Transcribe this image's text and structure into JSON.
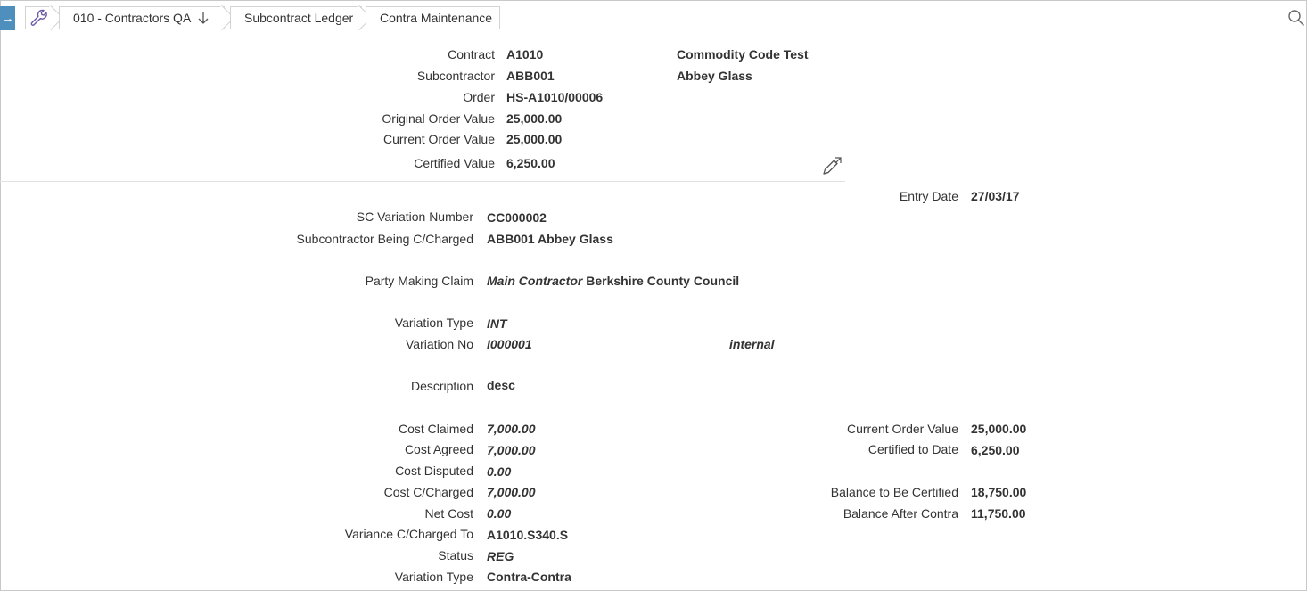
{
  "breadcrumb": {
    "company": "010 - Contractors QA",
    "ledger": "Subcontract Ledger",
    "page": "Contra Maintenance"
  },
  "header": {
    "contract_label": "Contract",
    "contract_value": "A1010",
    "contract_desc": "Commodity Code Test",
    "subcontractor_label": "Subcontractor",
    "subcontractor_value": "ABB001",
    "subcontractor_desc": "Abbey Glass",
    "order_label": "Order",
    "order_value": "HS-A1010/00006",
    "original_order_value_label": "Original Order Value",
    "original_order_value": "25,000.00",
    "current_order_value_label": "Current Order Value",
    "current_order_value": "25,000.00",
    "certified_value_label": "Certified Value",
    "certified_value": "6,250.00"
  },
  "detail": {
    "entry_date_label": "Entry Date",
    "entry_date": "27/03/17",
    "sc_variation_number_label": "SC Variation Number",
    "sc_variation_number": "CC000002",
    "subcontractor_charged_label": "Subcontractor Being C/Charged",
    "subcontractor_charged": "ABB001 Abbey Glass",
    "party_making_claim_label": "Party Making Claim",
    "party_making_claim_type": "Main Contractor",
    "party_making_claim_name": "Berkshire County Council",
    "variation_type_label": "Variation Type",
    "variation_type": "INT",
    "variation_no_label": "Variation No",
    "variation_no": "I000001",
    "variation_no_desc": "internal",
    "description_label": "Description",
    "description": "desc",
    "cost_claimed_label": "Cost Claimed",
    "cost_claimed": "7,000.00",
    "cost_agreed_label": "Cost Agreed",
    "cost_agreed": "7,000.00",
    "cost_disputed_label": "Cost Disputed",
    "cost_disputed": "0.00",
    "cost_ccharged_label": "Cost C/Charged",
    "cost_ccharged": "7,000.00",
    "net_cost_label": "Net Cost",
    "net_cost": "0.00",
    "variance_charged_to_label": "Variance C/Charged To",
    "variance_charged_to": "A1010.S340.S",
    "status_label": "Status",
    "status": "REG",
    "variation_type2_label": "Variation Type",
    "variation_type2": "Contra-Contra"
  },
  "summary": {
    "current_order_value_label": "Current Order Value",
    "current_order_value": "25,000.00",
    "certified_to_date_label": "Certified to Date",
    "certified_to_date": "6,250.00",
    "balance_to_be_certified_label": "Balance to Be Certified",
    "balance_to_be_certified": "18,750.00",
    "balance_after_contra_label": "Balance After Contra",
    "balance_after_contra": "11,750.00"
  },
  "colors": {
    "accent": "#4f8fbd",
    "tools_icon": "#6a5aa8",
    "border": "#d3d3d3",
    "text": "#333333"
  },
  "icons": {
    "nav": "arrow-right-icon",
    "tools": "wrench-icon",
    "sort": "arrow-down-icon",
    "search": "search-icon",
    "edit": "pencil-expand-icon"
  }
}
